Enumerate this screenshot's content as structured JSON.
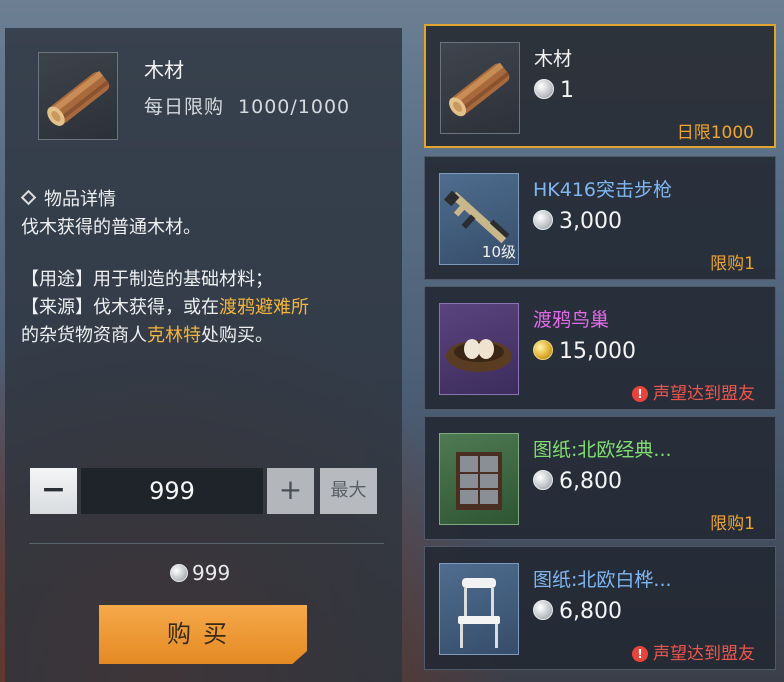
{
  "detail": {
    "name": "木材",
    "daily_limit_label": "每日限购",
    "daily_limit_value": "1000/1000",
    "section_title": "物品详情",
    "desc_line1": "伐木获得的普通木材。",
    "usage_prefix": "【用途】",
    "usage_text": "用于制造的基础材料；",
    "source_prefix": "【来源】",
    "source_text1": "伐木获得，或在",
    "source_place": "渡鸦避难所",
    "source_text2": "的杂货物资商人",
    "source_npc": "克林特",
    "source_text3": "处购买。",
    "minus_label": "−",
    "quantity": "999",
    "plus_label": "+",
    "max_label": "最大",
    "total_price": "999",
    "buy_label": "购买",
    "icon": "wood-log-icon"
  },
  "shop_items": [
    {
      "name": "木材",
      "price": "1",
      "currency": "silver",
      "limit": "日限1000",
      "limit_type": "normal",
      "name_color": "white",
      "frame": "gray",
      "icon": "wood-log-icon",
      "level": ""
    },
    {
      "name": "HK416突击步枪",
      "price": "3,000",
      "currency": "silver",
      "limit": "限购1",
      "limit_type": "normal",
      "name_color": "blue",
      "frame": "blue",
      "icon": "rifle-icon",
      "level": "10级"
    },
    {
      "name": "渡鸦鸟巢",
      "price": "15,000",
      "currency": "gold",
      "limit": "声望达到盟友",
      "limit_type": "warning",
      "name_color": "purple",
      "frame": "purple",
      "icon": "bird-nest-icon",
      "level": ""
    },
    {
      "name": "图纸:北欧经典...",
      "price": "6,800",
      "currency": "silver",
      "limit": "限购1",
      "limit_type": "normal",
      "name_color": "green",
      "frame": "green",
      "icon": "cabinet-icon",
      "level": ""
    },
    {
      "name": "图纸:北欧白桦...",
      "price": "6,800",
      "currency": "silver",
      "limit": "声望达到盟友",
      "limit_type": "warning",
      "name_color": "blue",
      "frame": "blue",
      "icon": "chair-icon",
      "level": ""
    }
  ],
  "colors": {
    "accent_orange": "#e48a24",
    "highlight_text": "#f3b53c",
    "selected_border": "#e0a531",
    "warning_red": "#f0544a"
  }
}
